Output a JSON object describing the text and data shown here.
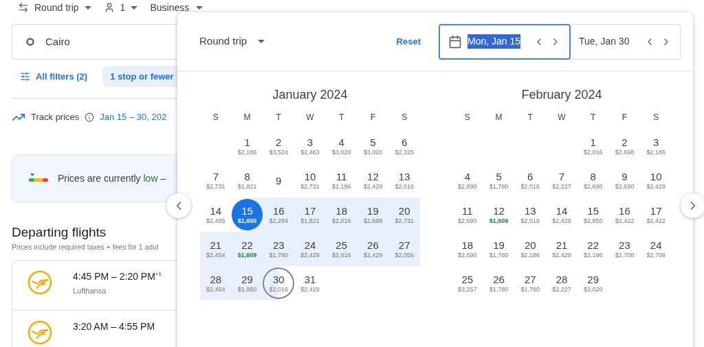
{
  "top_bar": {
    "trip_type": "Round trip",
    "passengers": "1",
    "cabin": "Business"
  },
  "origin_field": {
    "value": "Cairo"
  },
  "filters": {
    "all_filters": "All filters (2)",
    "chips": [
      {
        "label": "1 stop or fewer",
        "selected": true
      }
    ]
  },
  "track": {
    "label": "Track prices",
    "dates": "Jan 15 – 30, 202"
  },
  "insight": {
    "text": "Prices are currently **low** –"
  },
  "departing": {
    "title": "Departing flights",
    "subtitle": "Prices include required taxes + fees for 1 adul"
  },
  "flights": [
    {
      "times": "4:45 PM – 2:20 PM",
      "day_offset": "+1",
      "airline": "Lufthansa"
    },
    {
      "times": "3:20 AM – 4:55 PM"
    }
  ],
  "date_picker": {
    "trip_type": "Round trip",
    "reset": "Reset",
    "depart": {
      "value": "Mon, Jan 15",
      "focused": true
    },
    "return": {
      "value": "Tue, Jan 30",
      "focused": false
    },
    "months": [
      {
        "title": "January 2024",
        "weekdays": [
          "S",
          "M",
          "T",
          "W",
          "T",
          "F",
          "S"
        ],
        "weeks": [
          [
            {
              "kind": "blank"
            },
            {
              "kind": "day",
              "day": "1",
              "price": "$2,186",
              "low": false,
              "range_start": false,
              "range_end": false,
              "in_range": false
            },
            {
              "kind": "day",
              "day": "2",
              "price": "$3,524",
              "low": false,
              "range_start": false,
              "range_end": false,
              "in_range": false
            },
            {
              "kind": "day",
              "day": "3",
              "price": "$2,463",
              "low": false,
              "range_start": false,
              "range_end": false,
              "in_range": false
            },
            {
              "kind": "day",
              "day": "4",
              "price": "$3,020",
              "low": false,
              "range_start": false,
              "range_end": false,
              "in_range": false
            },
            {
              "kind": "day",
              "day": "5",
              "price": "$3,020",
              "low": false,
              "range_start": false,
              "range_end": false,
              "in_range": false
            },
            {
              "kind": "day",
              "day": "6",
              "price": "$2,325",
              "low": false,
              "range_start": false,
              "range_end": false,
              "in_range": false
            }
          ],
          [
            {
              "kind": "day",
              "day": "7",
              "price": "$2,731",
              "low": false,
              "range_start": false,
              "range_end": false,
              "in_range": false
            },
            {
              "kind": "day",
              "day": "8",
              "price": "$1,821",
              "low": false,
              "range_start": false,
              "range_end": false,
              "in_range": false
            },
            {
              "kind": "day",
              "day": "9",
              "range_start": false,
              "range_end": false,
              "in_range": false
            },
            {
              "kind": "day",
              "day": "10",
              "price": "$2,731",
              "low": false,
              "range_start": false,
              "range_end": false,
              "in_range": false
            },
            {
              "kind": "day",
              "day": "11",
              "price": "$2,186",
              "low": false,
              "range_start": false,
              "range_end": false,
              "in_range": false
            },
            {
              "kind": "day",
              "day": "12",
              "price": "$2,429",
              "low": false,
              "range_start": false,
              "range_end": false,
              "in_range": false
            },
            {
              "kind": "day",
              "day": "13",
              "price": "$2,016",
              "low": false,
              "range_start": false,
              "range_end": false,
              "in_range": false
            }
          ],
          [
            {
              "kind": "day",
              "day": "14",
              "price": "$2,495",
              "low": false,
              "range_start": false,
              "range_end": false,
              "in_range": false
            },
            {
              "kind": "day",
              "day": "15",
              "price": "$1,650",
              "low": false,
              "range_start": true,
              "range_end": false,
              "in_range": false
            },
            {
              "kind": "day",
              "day": "16",
              "price": "$2,284",
              "low": false,
              "range_start": false,
              "range_end": false,
              "in_range": true
            },
            {
              "kind": "day",
              "day": "17",
              "price": "$1,821",
              "low": false,
              "range_start": false,
              "range_end": false,
              "in_range": true
            },
            {
              "kind": "day",
              "day": "18",
              "price": "$2,016",
              "low": false,
              "range_start": false,
              "range_end": false,
              "in_range": true
            },
            {
              "kind": "day",
              "day": "19",
              "price": "$2,698",
              "low": false,
              "range_start": false,
              "range_end": false,
              "in_range": true
            },
            {
              "kind": "day",
              "day": "20",
              "price": "$2,731",
              "low": false,
              "range_start": false,
              "range_end": false,
              "in_range": true
            }
          ],
          [
            {
              "kind": "day",
              "day": "21",
              "price": "$2,454",
              "low": false,
              "range_start": false,
              "range_end": false,
              "in_range": true
            },
            {
              "kind": "day",
              "day": "22",
              "price": "$1,609",
              "low": true,
              "range_start": false,
              "range_end": false,
              "in_range": true
            },
            {
              "kind": "day",
              "day": "23",
              "price": "$1,780",
              "low": false,
              "range_start": false,
              "range_end": false,
              "in_range": true
            },
            {
              "kind": "day",
              "day": "24",
              "price": "$2,429",
              "low": false,
              "range_start": false,
              "range_end": false,
              "in_range": true
            },
            {
              "kind": "day",
              "day": "25",
              "price": "$2,016",
              "low": false,
              "range_start": false,
              "range_end": false,
              "in_range": true
            },
            {
              "kind": "day",
              "day": "26",
              "price": "$2,429",
              "low": false,
              "range_start": false,
              "range_end": false,
              "in_range": true
            },
            {
              "kind": "day",
              "day": "27",
              "price": "$2,056",
              "low": false,
              "range_start": false,
              "range_end": false,
              "in_range": true
            }
          ],
          [
            {
              "kind": "day",
              "day": "28",
              "price": "$2,454",
              "low": false,
              "range_start": false,
              "range_end": false,
              "in_range": true
            },
            {
              "kind": "day",
              "day": "29",
              "price": "$1,950",
              "low": false,
              "range_start": false,
              "range_end": false,
              "in_range": true
            },
            {
              "kind": "day",
              "day": "30",
              "price": "$2,016",
              "low": false,
              "range_start": false,
              "range_end": true,
              "in_range": false
            },
            {
              "kind": "day",
              "day": "31",
              "price": "$2,429",
              "low": false,
              "range_start": false,
              "range_end": false,
              "in_range": false
            }
          ]
        ]
      },
      {
        "title": "February 2024",
        "weekdays": [
          "S",
          "M",
          "T",
          "W",
          "T",
          "F",
          "S"
        ],
        "weeks": [
          [
            {
              "kind": "blank"
            },
            {
              "kind": "blank"
            },
            {
              "kind": "blank"
            },
            {
              "kind": "blank"
            },
            {
              "kind": "day",
              "day": "1",
              "price": "$2,016",
              "low": false,
              "range_start": false,
              "range_end": false,
              "in_range": false
            },
            {
              "kind": "day",
              "day": "2",
              "price": "$2,698",
              "low": false,
              "range_start": false,
              "range_end": false,
              "in_range": false
            },
            {
              "kind": "day",
              "day": "3",
              "price": "$2,186",
              "low": false,
              "range_start": false,
              "range_end": false,
              "in_range": false
            }
          ],
          [
            {
              "kind": "day",
              "day": "4",
              "price": "$2,690",
              "low": false,
              "range_start": false,
              "range_end": false,
              "in_range": false
            },
            {
              "kind": "day",
              "day": "5",
              "price": "$1,780",
              "low": false,
              "range_start": false,
              "range_end": false,
              "in_range": false
            },
            {
              "kind": "day",
              "day": "6",
              "price": "$2,016",
              "low": false,
              "range_start": false,
              "range_end": false,
              "in_range": false
            },
            {
              "kind": "day",
              "day": "7",
              "price": "$2,227",
              "low": false,
              "range_start": false,
              "range_end": false,
              "in_range": false
            },
            {
              "kind": "day",
              "day": "8",
              "price": "$2,690",
              "low": false,
              "range_start": false,
              "range_end": false,
              "in_range": false
            },
            {
              "kind": "day",
              "day": "9",
              "price": "$2,690",
              "low": false,
              "range_start": false,
              "range_end": false,
              "in_range": false
            },
            {
              "kind": "day",
              "day": "10",
              "price": "$2,429",
              "low": false,
              "range_start": false,
              "range_end": false,
              "in_range": false
            }
          ],
          [
            {
              "kind": "day",
              "day": "11",
              "price": "$2,690",
              "low": false,
              "range_start": false,
              "range_end": false,
              "in_range": false
            },
            {
              "kind": "day",
              "day": "12",
              "price": "$1,609",
              "low": true,
              "range_start": false,
              "range_end": false,
              "in_range": false
            },
            {
              "kind": "day",
              "day": "13",
              "price": "$2,016",
              "low": false,
              "range_start": false,
              "range_end": false,
              "in_range": false
            },
            {
              "kind": "day",
              "day": "14",
              "price": "$2,429",
              "low": false,
              "range_start": false,
              "range_end": false,
              "in_range": false
            },
            {
              "kind": "day",
              "day": "15",
              "price": "$2,850",
              "low": false,
              "range_start": false,
              "range_end": false,
              "in_range": false
            },
            {
              "kind": "day",
              "day": "16",
              "price": "$2,422",
              "low": false,
              "range_start": false,
              "range_end": false,
              "in_range": false
            },
            {
              "kind": "day",
              "day": "17",
              "price": "$2,422",
              "low": false,
              "range_start": false,
              "range_end": false,
              "in_range": false
            }
          ],
          [
            {
              "kind": "day",
              "day": "18",
              "price": "$2,690",
              "low": false,
              "range_start": false,
              "range_end": false,
              "in_range": false
            },
            {
              "kind": "day",
              "day": "19",
              "price": "$1,780",
              "low": false,
              "range_start": false,
              "range_end": false,
              "in_range": false
            },
            {
              "kind": "day",
              "day": "20",
              "price": "$2,186",
              "low": false,
              "range_start": false,
              "range_end": false,
              "in_range": false
            },
            {
              "kind": "day",
              "day": "21",
              "price": "$2,429",
              "low": false,
              "range_start": false,
              "range_end": false,
              "in_range": false
            },
            {
              "kind": "day",
              "day": "22",
              "price": "$2,186",
              "low": false,
              "range_start": false,
              "range_end": false,
              "in_range": false
            },
            {
              "kind": "day",
              "day": "23",
              "price": "$2,708",
              "low": false,
              "range_start": false,
              "range_end": false,
              "in_range": false
            },
            {
              "kind": "day",
              "day": "24",
              "price": "$2,708",
              "low": false,
              "range_start": false,
              "range_end": false,
              "in_range": false
            }
          ],
          [
            {
              "kind": "day",
              "day": "25",
              "price": "$3,257",
              "low": false,
              "range_start": false,
              "range_end": false,
              "in_range": false
            },
            {
              "kind": "day",
              "day": "26",
              "price": "$1,780",
              "low": false,
              "range_start": false,
              "range_end": false,
              "in_range": false
            },
            {
              "kind": "day",
              "day": "27",
              "price": "$1,780",
              "low": false,
              "range_start": false,
              "range_end": false,
              "in_range": false
            },
            {
              "kind": "day",
              "day": "28",
              "price": "$2,227",
              "low": false,
              "range_start": false,
              "range_end": false,
              "in_range": false
            },
            {
              "kind": "day",
              "day": "29",
              "price": "$3,020",
              "low": false,
              "range_start": false,
              "range_end": false,
              "in_range": false
            }
          ]
        ]
      }
    ]
  }
}
